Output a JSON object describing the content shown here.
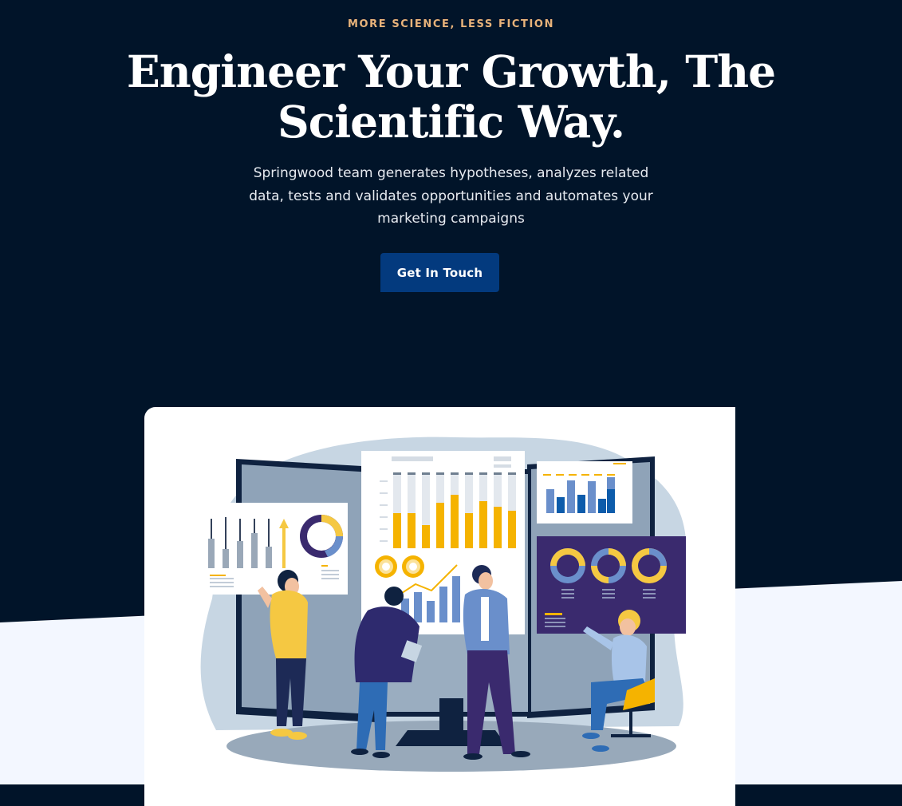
{
  "hero": {
    "eyebrow": "MORE SCIENCE, LESS FICTION",
    "title": "Engineer Your Growth, The Scientific Way.",
    "subtitle": "Springwood team generates hypotheses, analyzes related data, tests and validates opportunities and automates your marketing campaigns",
    "cta_label": "Get In Touch"
  },
  "colors": {
    "background_dark": "#011429",
    "background_light": "#F3F7FF",
    "eyebrow": "#E8B37A",
    "button": "#033A7E",
    "illustration_accent_yellow": "#F5B300",
    "illustration_accent_blue": "#2E6CB5",
    "illustration_accent_purple": "#3A2A6E"
  },
  "illustration": {
    "icon": "team-analytics-illustration"
  }
}
